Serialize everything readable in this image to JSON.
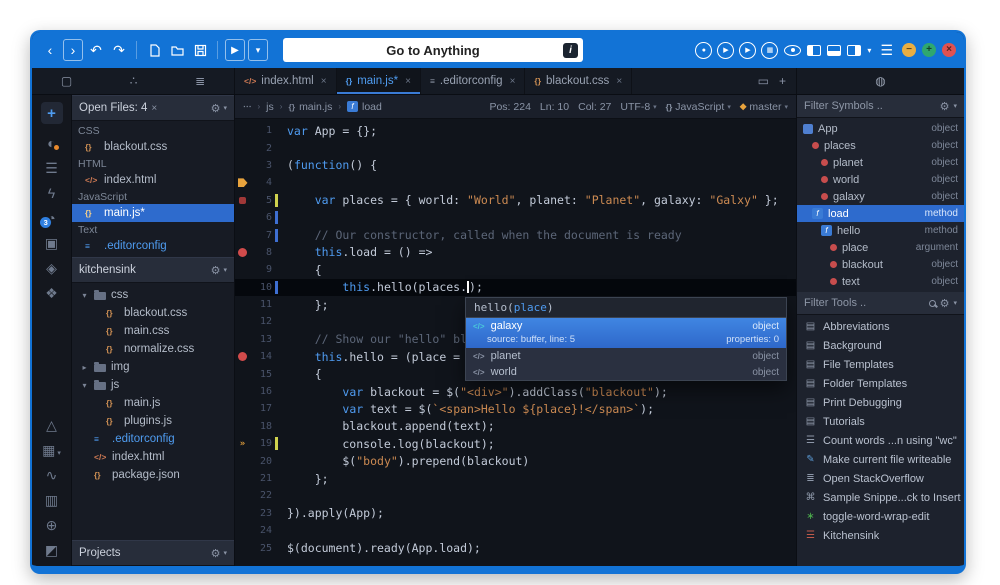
{
  "icons": {
    "gear": "⚙",
    "chevron": "▾",
    "separator": "›"
  },
  "toolbar": {
    "back": "‹",
    "forward": "›",
    "undo": "↶",
    "redo": "↷",
    "play": "▶",
    "chevron": "▾",
    "menu": "☰",
    "search_value": "Go to Anything",
    "search_badge": "i",
    "circles": [
      "●",
      "▶",
      "▶",
      "▦"
    ],
    "window_buttons": {
      "minimize": "−",
      "maximize": "+",
      "close": "×"
    }
  },
  "tabbar": {
    "side_icons": [
      {
        "name": "document-tab-icon",
        "glyph": "▢"
      },
      {
        "name": "komodo-tab-icon",
        "glyph": "∴"
      },
      {
        "name": "stack-tab-icon",
        "glyph": "≣"
      }
    ],
    "file_tabs": [
      {
        "label": "index.html",
        "glyph": "</>",
        "color": "#cf7a54",
        "active": false
      },
      {
        "label": "main.js*",
        "glyph": "{}",
        "color": "#4f9cf0",
        "active": true
      },
      {
        "label": ".editorconfig",
        "glyph": "≡",
        "color": "#8b94a4",
        "active": false
      },
      {
        "label": "blackout.css",
        "glyph": "{}",
        "color": "#cf9054",
        "active": false
      }
    ],
    "preview_icon": "▭",
    "new_tab": "+",
    "right_panel_icon": "◍"
  },
  "left_strip": {
    "plus": "+",
    "top": [
      {
        "name": "colorscheme-icon",
        "glyph": "◐",
        "accent": "#e8892c"
      },
      {
        "name": "outline-icon",
        "glyph": "☰"
      },
      {
        "name": "lightning-icon",
        "glyph": "ϟ"
      },
      {
        "name": "history-icon",
        "glyph": "◔",
        "badge": "3"
      },
      {
        "name": "panel-icon",
        "glyph": "▣"
      },
      {
        "name": "notes-icon",
        "glyph": "◈"
      },
      {
        "name": "share-icon",
        "glyph": "❖"
      }
    ],
    "bottom": [
      {
        "name": "flask-icon",
        "glyph": "△"
      },
      {
        "name": "apps-icon",
        "glyph": "▦",
        "chev": true
      },
      {
        "name": "chart-icon",
        "glyph": "∿"
      },
      {
        "name": "package-icon",
        "glyph": "▥"
      },
      {
        "name": "globe-icon",
        "glyph": "⊕"
      },
      {
        "name": "puzzle-icon",
        "glyph": "◩"
      }
    ]
  },
  "open_files": {
    "title": "Open Files: 4",
    "close": "×",
    "groups": [
      {
        "label": "CSS",
        "items": [
          {
            "name": "blackout.css",
            "glyph": "{}",
            "color": "#cf9054"
          }
        ]
      },
      {
        "label": "HTML",
        "items": [
          {
            "name": "index.html",
            "glyph": "</>",
            "color": "#cf7a54"
          }
        ]
      },
      {
        "label": "JavaScript",
        "items": [
          {
            "name": "main.js*",
            "glyph": "{}",
            "color": "#f5d08c",
            "selected": true
          }
        ]
      },
      {
        "label": "Text",
        "items": [
          {
            "name": ".editorconfig",
            "glyph": "≡",
            "color": "#4f9cf0",
            "blue": true
          }
        ]
      }
    ]
  },
  "places": {
    "title": "kitchensink",
    "projects_label": "Projects",
    "tree": [
      {
        "label": "css",
        "kind": "folder",
        "depth": 0,
        "exp": "▾"
      },
      {
        "label": "blackout.css",
        "kind": "file",
        "glyph": "{}",
        "color": "#cf9054",
        "depth": 1
      },
      {
        "label": "main.css",
        "kind": "file",
        "glyph": "{}",
        "color": "#cf9054",
        "depth": 1
      },
      {
        "label": "normalize.css",
        "kind": "file",
        "glyph": "{}",
        "color": "#cf9054",
        "depth": 1
      },
      {
        "label": "img",
        "kind": "folder",
        "depth": 0,
        "exp": "▸"
      },
      {
        "label": "js",
        "kind": "folder",
        "depth": 0,
        "exp": "▾"
      },
      {
        "label": "main.js",
        "kind": "file",
        "glyph": "{}",
        "color": "#cf9054",
        "depth": 1
      },
      {
        "label": "plugins.js",
        "kind": "file",
        "glyph": "{}",
        "color": "#cf9054",
        "depth": 1
      },
      {
        "label": ".editorconfig",
        "kind": "file",
        "glyph": "≡",
        "color": "#4f9cf0",
        "depth": 0,
        "blue": true
      },
      {
        "label": "index.html",
        "kind": "file",
        "glyph": "</>",
        "color": "#cf7a54",
        "depth": 0
      },
      {
        "label": "package.json",
        "kind": "file",
        "glyph": "{}",
        "color": "#cf9054",
        "depth": 0
      }
    ]
  },
  "editor": {
    "breadcrumb": [
      {
        "glyph": "⋯",
        "label": ""
      },
      {
        "glyph": "",
        "label": "js"
      },
      {
        "glyph": "{}",
        "label": "main.js"
      },
      {
        "glyph": "f",
        "label": "load",
        "fn": true
      }
    ],
    "status": [
      {
        "label": "Pos: 224"
      },
      {
        "label": "Ln: 10"
      },
      {
        "label": "Col: 27"
      },
      {
        "label": "UTF-8",
        "chev": true
      },
      {
        "glyph": "{}",
        "label": "JavaScript",
        "chev": true
      },
      {
        "glyph": "◆",
        "glyph_color": "#e8a33d",
        "label": "master",
        "chev": true
      }
    ],
    "lines": [
      {
        "n": 1,
        "t": [
          [
            "k",
            "var"
          ],
          [
            "d",
            " App = {};"
          ]
        ]
      },
      {
        "n": 2,
        "t": []
      },
      {
        "n": 3,
        "t": [
          [
            "d",
            "("
          ],
          [
            "k",
            "function"
          ],
          [
            "d",
            "() {"
          ]
        ]
      },
      {
        "n": 4,
        "t": [],
        "g": "bm"
      },
      {
        "n": 5,
        "t": [
          [
            "d",
            "    "
          ],
          [
            "k",
            "var"
          ],
          [
            "d",
            " places = { world: "
          ],
          [
            "s",
            "\"World\""
          ],
          [
            "d",
            ", planet: "
          ],
          [
            "s",
            "\"Planet\""
          ],
          [
            "d",
            ", galaxy: "
          ],
          [
            "s",
            "\"Galxy\""
          ],
          [
            "d",
            " };"
          ]
        ],
        "g": "sq",
        "ch": "y"
      },
      {
        "n": 6,
        "t": [],
        "ch": "b"
      },
      {
        "n": 7,
        "t": [
          [
            "c",
            "    // Our constructor, called when the document is ready"
          ]
        ],
        "ch": "b"
      },
      {
        "n": 8,
        "t": [
          [
            "d",
            "    "
          ],
          [
            "k",
            "this"
          ],
          [
            "d",
            ".load = () =>"
          ]
        ],
        "g": "bp"
      },
      {
        "n": 9,
        "t": [
          [
            "d",
            "    {"
          ]
        ]
      },
      {
        "n": 10,
        "t": [
          [
            "d",
            "        "
          ],
          [
            "k",
            "this"
          ],
          [
            "d",
            ".hello(places."
          ],
          [
            "caret",
            ""
          ],
          [
            "d",
            ");"
          ]
        ],
        "ch": "b",
        "cur": true
      },
      {
        "n": 11,
        "t": [
          [
            "d",
            "    };"
          ]
        ]
      },
      {
        "n": 12,
        "t": []
      },
      {
        "n": 13,
        "t": [
          [
            "c",
            "    // Show our \"hello\" bl"
          ]
        ]
      },
      {
        "n": 14,
        "t": [
          [
            "d",
            "    "
          ],
          [
            "k",
            "this"
          ],
          [
            "d",
            ".hello = (place ="
          ]
        ],
        "g": "bp"
      },
      {
        "n": 15,
        "t": [
          [
            "d",
            "    {"
          ]
        ]
      },
      {
        "n": 16,
        "t": [
          [
            "d",
            "        "
          ],
          [
            "k",
            "var"
          ],
          [
            "d",
            " blackout = $("
          ],
          [
            "s",
            "\"<div>\""
          ],
          [
            "d",
            ").addClass("
          ],
          [
            "s",
            "\"blackout\""
          ],
          [
            "d",
            ");"
          ]
        ]
      },
      {
        "n": 17,
        "t": [
          [
            "d",
            "        "
          ],
          [
            "k",
            "var"
          ],
          [
            "d",
            " text = $("
          ],
          [
            "s",
            "`<span>Hello ${place}!</span>`"
          ],
          [
            "d",
            ");"
          ]
        ]
      },
      {
        "n": 18,
        "t": [
          [
            "d",
            "        blackout.append(text);"
          ]
        ]
      },
      {
        "n": 19,
        "t": [
          [
            "d",
            "        console.log(blackout);"
          ]
        ],
        "g": "wr",
        "ch": "y"
      },
      {
        "n": 20,
        "t": [
          [
            "d",
            "        $("
          ],
          [
            "s",
            "\"body\""
          ],
          [
            "d",
            ").prepend(blackout)"
          ]
        ]
      },
      {
        "n": 21,
        "t": [
          [
            "d",
            "    };"
          ]
        ]
      },
      {
        "n": 22,
        "t": []
      },
      {
        "n": 23,
        "t": [
          [
            "d",
            "}).apply(App);"
          ]
        ]
      },
      {
        "n": 24,
        "t": []
      },
      {
        "n": 25,
        "t": [
          [
            "d",
            "$(document).ready(App.load);"
          ]
        ]
      }
    ]
  },
  "popup": {
    "signature": {
      "prefix": "hello(",
      "arg": "place",
      "suffix": ")"
    },
    "items": [
      {
        "glyph": "</>",
        "glyph_color": "#49c7da",
        "name": "galaxy",
        "type": "object",
        "selected": true,
        "sub_left": "source: buffer, line: 5",
        "sub_right": "properties: 0"
      },
      {
        "glyph": "</>",
        "glyph_color": "#8a93a5",
        "name": "planet",
        "type": "object"
      },
      {
        "glyph": "</>",
        "glyph_color": "#8a93a5",
        "name": "world",
        "type": "object"
      }
    ]
  },
  "symbols": {
    "filter_label": "Filter Symbols ..",
    "items": [
      {
        "name": "App",
        "type": "object",
        "depth": 0,
        "icon": "obj"
      },
      {
        "name": "places",
        "type": "object",
        "depth": 1,
        "icon": "var"
      },
      {
        "name": "planet",
        "type": "object",
        "depth": 2,
        "icon": "var"
      },
      {
        "name": "world",
        "type": "object",
        "depth": 2,
        "icon": "var"
      },
      {
        "name": "galaxy",
        "type": "object",
        "depth": 2,
        "icon": "var"
      },
      {
        "name": "load",
        "type": "method",
        "depth": 1,
        "icon": "fn",
        "selected": true
      },
      {
        "name": "hello",
        "type": "method",
        "depth": 2,
        "icon": "fn"
      },
      {
        "name": "place",
        "type": "argument",
        "depth": 3,
        "icon": "var"
      },
      {
        "name": "blackout",
        "type": "object",
        "depth": 3,
        "icon": "var"
      },
      {
        "name": "text",
        "type": "object",
        "depth": 3,
        "icon": "var"
      }
    ]
  },
  "tools": {
    "filter_label": "Filter Tools ..",
    "items": [
      {
        "label": "Abbreviations",
        "glyph": "▤",
        "color": "#8d97a8"
      },
      {
        "label": "Background",
        "glyph": "▤",
        "color": "#8d97a8"
      },
      {
        "label": "File Templates",
        "glyph": "▤",
        "color": "#8d97a8"
      },
      {
        "label": "Folder Templates",
        "glyph": "▤",
        "color": "#8d97a8"
      },
      {
        "label": "Print Debugging",
        "glyph": "▤",
        "color": "#8d97a8"
      },
      {
        "label": "Tutorials",
        "glyph": "▤",
        "color": "#8d97a8"
      },
      {
        "label": "Count words ...n using \"wc\"",
        "glyph": "☰",
        "color": "#8d97a8"
      },
      {
        "label": "Make current file writeable",
        "glyph": "✎",
        "color": "#5b9bd5"
      },
      {
        "label": "Open StackOverflow",
        "glyph": "≣",
        "color": "#8d97a8"
      },
      {
        "label": "Sample Snippe...ck to Insert",
        "glyph": "⌘",
        "color": "#8d97a8"
      },
      {
        "label": "toggle-word-wrap-edit",
        "glyph": "∗",
        "color": "#4cae4c"
      },
      {
        "label": "Kitchensink",
        "glyph": "☰",
        "color": "#c05a4a"
      }
    ]
  }
}
